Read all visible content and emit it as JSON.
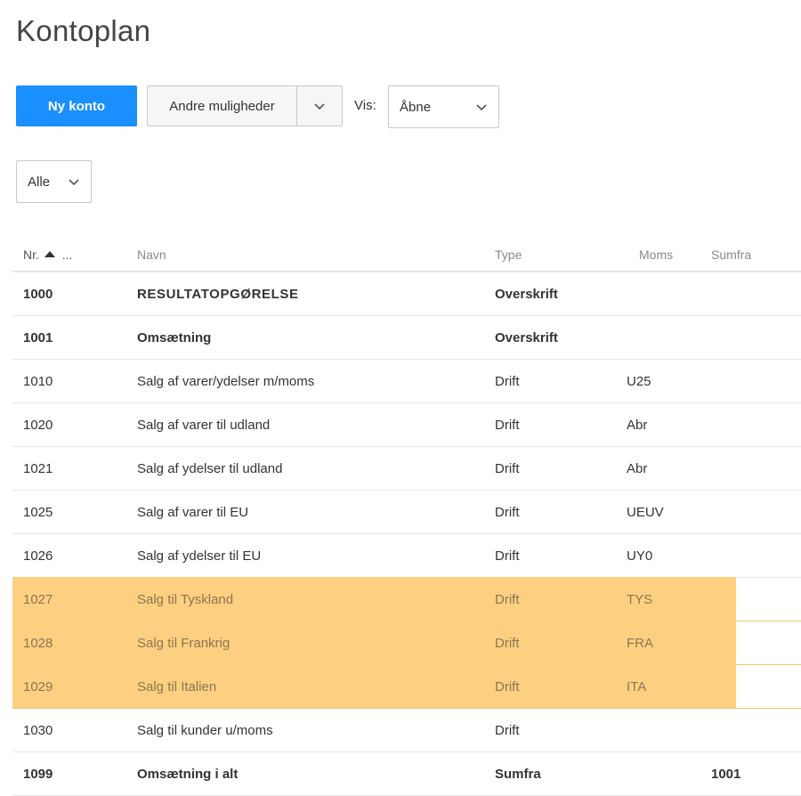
{
  "page": {
    "title": "Kontoplan"
  },
  "toolbar": {
    "new_account_label": "Ny konto",
    "more_options_label": "Andre muligheder",
    "vis_label": "Vis:",
    "vis_value": "Åbne",
    "filter_value": "Alle"
  },
  "colors": {
    "primary": "#1a8fff",
    "highlight": "#fdd081"
  },
  "table": {
    "headers": {
      "nr": "Nr.",
      "nr_more": "...",
      "navn": "Navn",
      "type": "Type",
      "moms": "Moms",
      "sumfra": "Sumfra"
    },
    "sort": {
      "column": "nr",
      "direction": "ascending"
    },
    "rows": [
      {
        "nr": "1000",
        "navn": "RESULTATOPGØRELSE",
        "type": "Overskrift",
        "moms": "",
        "sumfra": "",
        "bold": true,
        "highlight": false
      },
      {
        "nr": "1001",
        "navn": "Omsætning",
        "type": "Overskrift",
        "moms": "",
        "sumfra": "",
        "bold": true,
        "highlight": false
      },
      {
        "nr": "1010",
        "navn": "Salg af varer/ydelser m/moms",
        "type": "Drift",
        "moms": "U25",
        "sumfra": "",
        "bold": false,
        "highlight": false
      },
      {
        "nr": "1020",
        "navn": "Salg af varer til udland",
        "type": "Drift",
        "moms": "Abr",
        "sumfra": "",
        "bold": false,
        "highlight": false
      },
      {
        "nr": "1021",
        "navn": "Salg af ydelser til udland",
        "type": "Drift",
        "moms": "Abr",
        "sumfra": "",
        "bold": false,
        "highlight": false
      },
      {
        "nr": "1025",
        "navn": "Salg af varer til EU",
        "type": "Drift",
        "moms": "UEUV",
        "sumfra": "",
        "bold": false,
        "highlight": false
      },
      {
        "nr": "1026",
        "navn": "Salg af ydelser til EU",
        "type": "Drift",
        "moms": "UY0",
        "sumfra": "",
        "bold": false,
        "highlight": false
      },
      {
        "nr": "1027",
        "navn": "Salg til Tyskland",
        "type": "Drift",
        "moms": "TYS",
        "sumfra": "",
        "bold": false,
        "highlight": true
      },
      {
        "nr": "1028",
        "navn": "Salg til Frankrig",
        "type": "Drift",
        "moms": "FRA",
        "sumfra": "",
        "bold": false,
        "highlight": true
      },
      {
        "nr": "1029",
        "navn": "Salg til Italien",
        "type": "Drift",
        "moms": "ITA",
        "sumfra": "",
        "bold": false,
        "highlight": true
      },
      {
        "nr": "1030",
        "navn": "Salg til kunder u/moms",
        "type": "Drift",
        "moms": "",
        "sumfra": "",
        "bold": false,
        "highlight": false
      },
      {
        "nr": "1099",
        "navn": "Omsætning i alt",
        "type": "Sumfra",
        "moms": "",
        "sumfra": "1001",
        "bold": true,
        "highlight": false
      }
    ]
  }
}
